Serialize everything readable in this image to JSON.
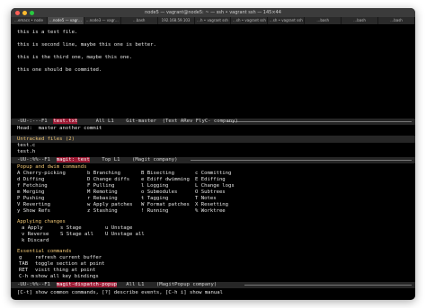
{
  "window": {
    "title": "node5 — vagrant@node5: ~ — ssh • vagrant ssh — 145×44"
  },
  "tabs": [
    {
      "label": "…emacs • node",
      "active": false
    },
    {
      "label": "…node5 — vagr…",
      "active": true
    },
    {
      "label": "…node3 — vagr…",
      "active": false
    },
    {
      "label": "…bash",
      "active": false
    },
    {
      "label": "192.168.59.103",
      "active": false
    },
    {
      "label": "…h • vagrant ssh",
      "active": false
    },
    {
      "label": "…sh • vagrant ssh",
      "active": false
    },
    {
      "label": "…sh • vagrant ssh",
      "active": false
    },
    {
      "label": "…bash",
      "active": false
    },
    {
      "label": "…bash",
      "active": false
    },
    {
      "label": "…bash",
      "active": false
    }
  ],
  "buffer": {
    "lines": [
      "this is a test file.",
      "",
      "this is second line, maybe this one is better.",
      "",
      "this is the third one, maybe this one.",
      "",
      "this one should be commited."
    ]
  },
  "modeline_file": {
    "prefix": "-UU-:---F1  ",
    "name": "test.txt",
    "rest": "      All L1    Git-master  (Text ARev FlyC- company) "
  },
  "magit": {
    "head_label": "Head:",
    "head_value": "master another commit",
    "untracked_title": "Untracked files (2)",
    "untracked_files": [
      "test.c",
      "test.h"
    ]
  },
  "modeline_magit": {
    "prefix": "-UU-:%%--F1  ",
    "name": "magit: test",
    "rest": "    Top L1    (Magit company) "
  },
  "popup": {
    "title": "Popup and dwim commands",
    "rows": [
      [
        "A Cherry-picking",
        "b Branching",
        "B Bisecting",
        "c Committing"
      ],
      [
        "d Diffing",
        "D Change diffs",
        "e Ediff dwimming",
        "E Ediffing"
      ],
      [
        "f Fetching",
        "F Pulling",
        "l Logging",
        "L Change logs"
      ],
      [
        "m Merging",
        "M Remoting",
        "o Submodules",
        "O Subtrees"
      ],
      [
        "P Pushing",
        "r Rebasing",
        "t Tagging",
        "T Notes"
      ],
      [
        "V Reverting",
        "w Apply patches",
        "W Format patches",
        "X Resetting"
      ],
      [
        "y Show Refs",
        "z Stashing",
        "! Running",
        "% Worktree"
      ]
    ]
  },
  "applying": {
    "title": "Applying changes",
    "rows": [
      [
        "a Apply",
        "s Stage",
        "u Unstage"
      ],
      [
        "v Reverse",
        "S Stage all",
        "U Unstage all"
      ],
      [
        "k Discard",
        "",
        ""
      ]
    ]
  },
  "essential": {
    "title": "Essential commands",
    "rows": [
      [
        "g",
        "refresh current buffer"
      ],
      [
        "TAB",
        "toggle section at point"
      ],
      [
        "RET",
        "visit thing at point"
      ],
      [
        "C-h m",
        "show all key bindings"
      ]
    ]
  },
  "modeline_dispatch": {
    "prefix": "-UU-:%%--F1  ",
    "name": "magit-dispatch-popup",
    "rest": "   All L1    (MagitPopup company) "
  },
  "minibuffer": "[C-t] show common commands, [?] describe events, [C-h i] show manual",
  "colors": {
    "modeline_highlight": "#9c1a34",
    "section_title": "#f0c674",
    "key": "#7fd3ff",
    "terminal_bg": "#000000"
  }
}
